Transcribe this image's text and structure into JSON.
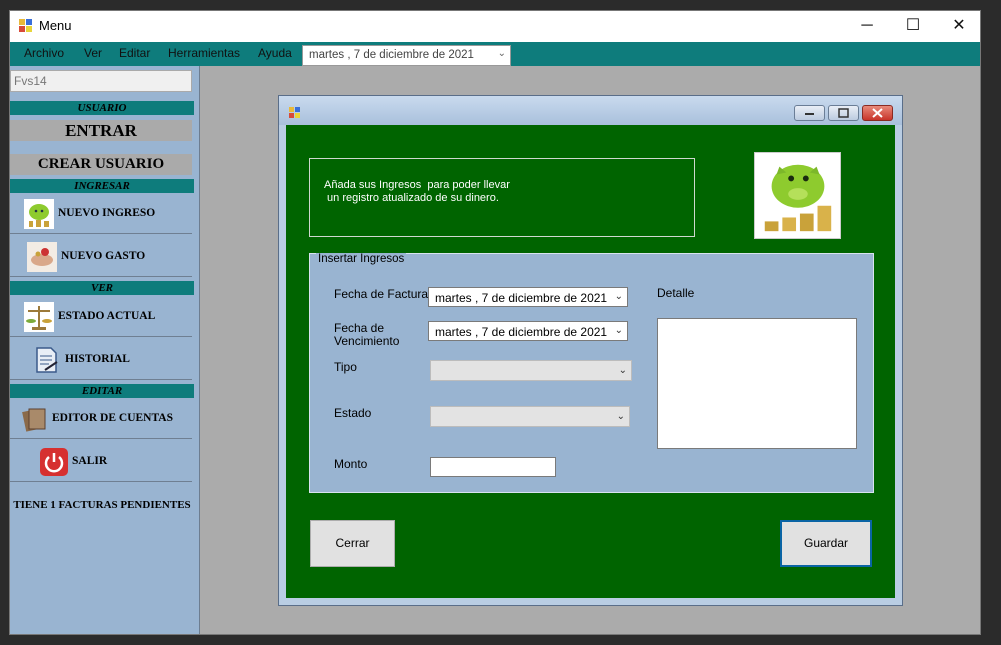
{
  "window": {
    "title": "Menu",
    "minimize_glyph": "─",
    "maximize_glyph": "☐",
    "close_glyph": "✕"
  },
  "menubar": {
    "items": [
      "Archivo",
      "Ver",
      "Editar",
      "Herramientas",
      "Ayuda"
    ],
    "date_value": "martes  ,   7 de  diciembre  de 2021"
  },
  "sidebar": {
    "user_field": "Fvs14",
    "header_usuario": "USUARIO",
    "entrar_label": "ENTRAR",
    "crear_usuario_label": "CREAR USUARIO",
    "header_ingresar": "INGRESAR",
    "nuevo_ingreso_label": "NUEVO INGRESO",
    "nuevo_gasto_label": "NUEVO GASTO",
    "header_ver": "VER",
    "estado_actual_label": "ESTADO ACTUAL",
    "historial_label": "HISTORIAL",
    "header_editar": "EDITAR",
    "editor_cuentas_label": "EDITOR DE CUENTAS",
    "salir_label": "SALIR",
    "pending_text": "TIENE 1 FACTURAS PENDIENTES"
  },
  "dialog": {
    "info_text": "Añada sus Ingresos  para poder llevar\n un registro atualizado de su dinero.",
    "group_title": "Insertar Ingresos",
    "fecha_factura_label": "Fecha de Factura",
    "fecha_factura_value": "martes  ,   7 de  diciembre  de 2021",
    "fecha_venc_label": "Fecha de\nVencimiento",
    "fecha_venc_value": "martes  ,   7 de  diciembre  de 2021",
    "tipo_label": "Tipo",
    "tipo_value": "",
    "estado_label": "Estado",
    "estado_value": "",
    "monto_label": "Monto",
    "monto_value": "",
    "detalle_label": "Detalle",
    "detalle_value": "",
    "cerrar_label": "Cerrar",
    "guardar_label": "Guardar"
  },
  "colors": {
    "teal": "#0e7c7c",
    "sidebar_bg": "#99b4d1",
    "form_green": "#006400",
    "button_gray": "#aaaaaa"
  },
  "icons": [
    "app-icon",
    "piggy-bank-icon",
    "hand-coins-icon",
    "scale-icon",
    "document-icon",
    "accounts-icon",
    "power-icon",
    "chevron-down-icon"
  ]
}
